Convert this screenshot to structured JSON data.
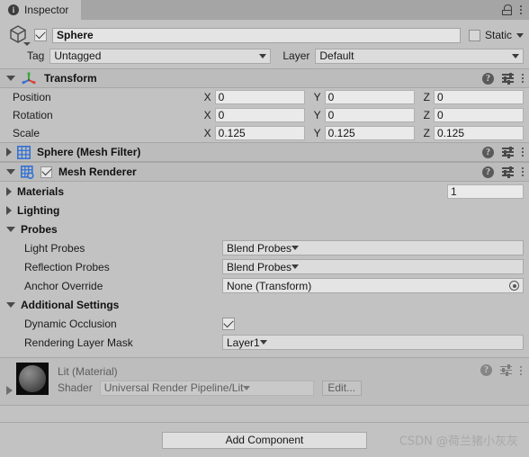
{
  "window": {
    "tab_label": "Inspector",
    "tab_icon": "info-icon",
    "lock_icon": "lock-icon",
    "menu_icon": "kebab-menu-icon"
  },
  "object_header": {
    "icon": "cube-icon",
    "enabled": true,
    "name": "Sphere",
    "static_label": "Static",
    "static_checked": false,
    "tag_label": "Tag",
    "tag_value": "Untagged",
    "layer_label": "Layer",
    "layer_value": "Default"
  },
  "components": [
    {
      "id": "transform",
      "title": "Transform",
      "icon": "transform-gizmo-icon",
      "expanded": true,
      "rows": [
        {
          "label": "Position",
          "x": "0",
          "y": "0",
          "z": "0"
        },
        {
          "label": "Rotation",
          "x": "0",
          "y": "0",
          "z": "0"
        },
        {
          "label": "Scale",
          "x": "0.125",
          "y": "0.125",
          "z": "0.125"
        }
      ],
      "axis_labels": {
        "x": "X",
        "y": "Y",
        "z": "Z"
      },
      "header_icons": [
        "help-icon",
        "preset-icon",
        "kebab-menu-icon"
      ]
    },
    {
      "id": "mesh-filter",
      "title": "Sphere (Mesh Filter)",
      "icon": "mesh-filter-icon",
      "expanded": false,
      "header_icons": [
        "help-icon",
        "preset-icon",
        "kebab-menu-icon"
      ]
    },
    {
      "id": "mesh-renderer",
      "title": "Mesh Renderer",
      "icon": "mesh-renderer-icon",
      "expanded": true,
      "enabled": true,
      "header_icons": [
        "help-icon",
        "preset-icon",
        "kebab-menu-icon"
      ]
    }
  ],
  "mesh_renderer": {
    "materials": {
      "label": "Materials",
      "expanded": false,
      "count": "1"
    },
    "lighting": {
      "label": "Lighting",
      "expanded": false
    },
    "probes": {
      "label": "Probes",
      "expanded": true,
      "light_probes_label": "Light Probes",
      "light_probes_value": "Blend Probes",
      "reflection_probes_label": "Reflection Probes",
      "reflection_probes_value": "Blend Probes",
      "anchor_override_label": "Anchor Override",
      "anchor_override_value": "None (Transform)"
    },
    "additional_settings": {
      "label": "Additional Settings",
      "expanded": true,
      "dynamic_occlusion_label": "Dynamic Occlusion",
      "dynamic_occlusion_checked": true,
      "rendering_layer_mask_label": "Rendering Layer Mask",
      "rendering_layer_mask_value": "Layer1"
    }
  },
  "material_preview": {
    "title": "Lit (Material)",
    "shader_label": "Shader",
    "shader_value": "Universal Render Pipeline/Lit",
    "edit_label": "Edit...",
    "expanded": false,
    "header_icons": [
      "help-icon",
      "preset-icon",
      "kebab-menu-icon"
    ]
  },
  "footer": {
    "add_component_label": "Add Component",
    "watermark": "CSDN @荷兰猪小灰灰"
  },
  "colors": {
    "panel_bg": "#c2c2c2",
    "header_bg": "#bcbcbc",
    "tabbar_bg": "#a5a5a5",
    "field_bg": "#eaeaea",
    "dropdown_bg": "#dcdcdc",
    "accent_blue": "#2c6fd4",
    "axis_x": "#d8413a",
    "axis_y": "#3aa83a",
    "axis_z": "#3a6fd8"
  }
}
